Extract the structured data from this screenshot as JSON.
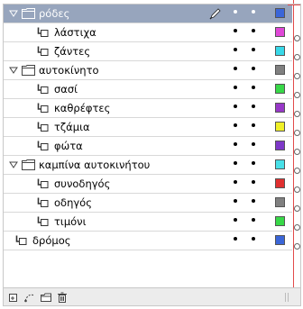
{
  "layers": [
    {
      "label": "ρόδες",
      "type": "folder",
      "indent": 0,
      "selected": true,
      "color": "#3b66d8"
    },
    {
      "label": "λάστιχα",
      "type": "layer",
      "indent": 1,
      "selected": false,
      "color": "#e048d8"
    },
    {
      "label": "ζάντες",
      "type": "layer",
      "indent": 1,
      "selected": false,
      "color": "#38d8e8"
    },
    {
      "label": "αυτοκίνητο",
      "type": "folder",
      "indent": 0,
      "selected": false,
      "color": "#808080"
    },
    {
      "label": "σασί",
      "type": "layer",
      "indent": 1,
      "selected": false,
      "color": "#38d848"
    },
    {
      "label": "καθρέφτες",
      "type": "layer",
      "indent": 1,
      "selected": false,
      "color": "#9838c8"
    },
    {
      "label": "τζάμια",
      "type": "layer",
      "indent": 1,
      "selected": false,
      "color": "#f0f028"
    },
    {
      "label": "φώτα",
      "type": "layer",
      "indent": 1,
      "selected": false,
      "color": "#7e38c8"
    },
    {
      "label": "καμπίνα αυτοκινήτου",
      "type": "folder",
      "indent": 0,
      "selected": false,
      "color": "#48e0e8"
    },
    {
      "label": "συνοδηγός",
      "type": "layer",
      "indent": 1,
      "selected": false,
      "color": "#e03030"
    },
    {
      "label": "οδηγός",
      "type": "layer",
      "indent": 1,
      "selected": false,
      "color": "#808080"
    },
    {
      "label": "τιμόνι",
      "type": "layer",
      "indent": 1,
      "selected": false,
      "color": "#38d848"
    },
    {
      "label": "δρόμος",
      "type": "layer",
      "indent": 0,
      "selected": false,
      "color": "#3b66d8"
    }
  ],
  "toolbar": {
    "buttons": [
      "new-layer-icon",
      "motion-guide-icon",
      "new-folder-icon",
      "trash-icon"
    ]
  },
  "colors": {
    "selected_row": "#97a5bd",
    "timeline_line": "#e24b4b"
  }
}
